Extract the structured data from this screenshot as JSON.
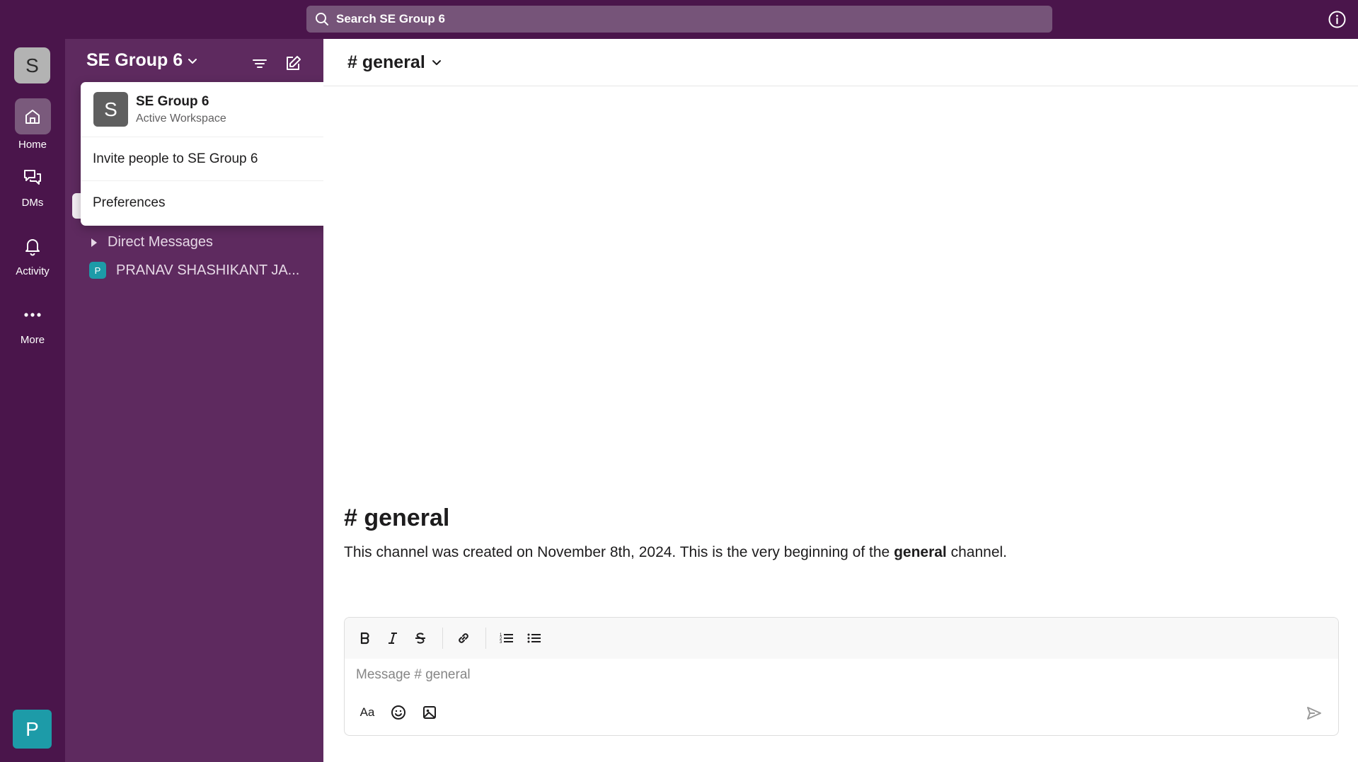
{
  "search": {
    "placeholder": "Search SE Group 6"
  },
  "rail": {
    "workspace_initial": "S",
    "items": [
      {
        "label": "Home",
        "icon": "home-icon"
      },
      {
        "label": "DMs",
        "icon": "dms-icon"
      },
      {
        "label": "Activity",
        "icon": "bell-icon"
      },
      {
        "label": "More",
        "icon": "more-icon"
      }
    ],
    "user_initial": "P"
  },
  "sidebar": {
    "workspace_name": "SE Group 6",
    "sections": [
      {
        "label": "Direct Messages"
      }
    ],
    "dms": [
      {
        "initial": "P",
        "name": "PRANAV SHASHIKANT JA..."
      }
    ]
  },
  "workspace_menu": {
    "avatar_initial": "S",
    "name": "SE Group 6",
    "subtitle": "Active Workspace",
    "items": [
      {
        "label": "Invite people to SE Group 6"
      },
      {
        "label": "Preferences"
      }
    ]
  },
  "channel": {
    "header_name": "# general",
    "intro_title": "# general",
    "intro_prefix": "This channel was created on November 8th, 2024. This is the very beginning of the ",
    "intro_bold": "general",
    "intro_suffix": " channel."
  },
  "composer": {
    "placeholder": "Message # general",
    "format_label": "Aa"
  },
  "colors": {
    "topbar": "#4a154b",
    "sidebar": "#5e2a5f",
    "accent_teal": "#1d9ba8"
  }
}
